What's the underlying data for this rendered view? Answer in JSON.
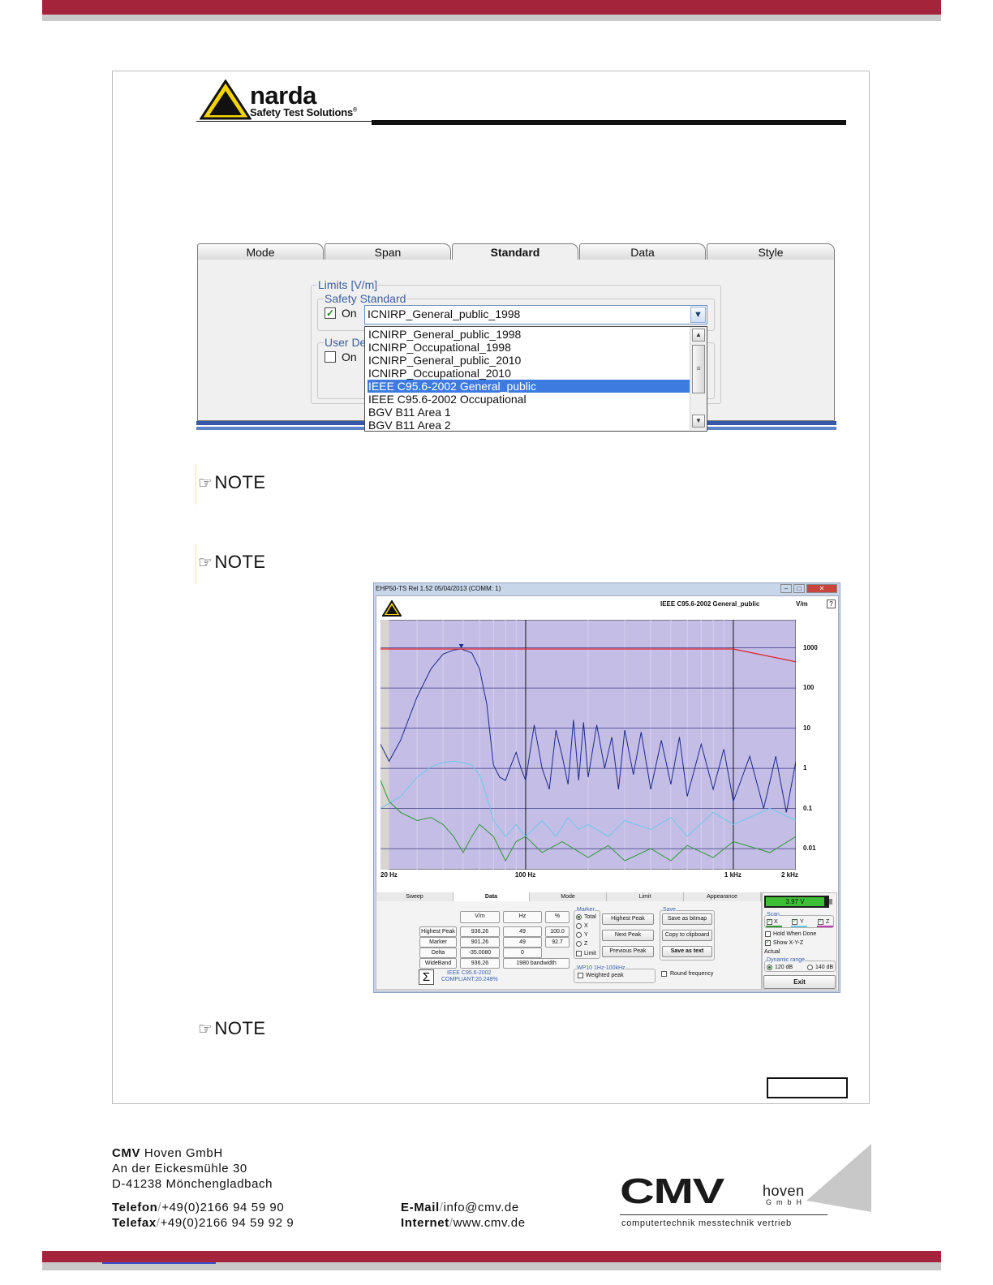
{
  "header": {
    "logo_name": "narda",
    "logo_sub": "Safety Test Solutions",
    "logo_reg": "®"
  },
  "tabs": [
    "Mode",
    "Span",
    "Standard",
    "Data",
    "Style"
  ],
  "limits": {
    "group_label": "Limits [V/m]",
    "safety_label": "Safety Standard",
    "on_label": "On",
    "selected": "ICNIRP_General_public_1998",
    "user_label": "User De",
    "user_on_label": "On",
    "options": [
      "ICNIRP_General_public_1998",
      "ICNIRP_Occupational_1998",
      "ICNIRP_General_public_2010",
      "ICNIRP_Occupational_2010",
      "IEEE C95.6-2002 General_public",
      "IEEE C95.6-2002 Occupational",
      "BGV B11 Area 1",
      "BGV B11 Area 2"
    ],
    "highlighted_index": 4
  },
  "notes": [
    "NOTE",
    "NOTE",
    "NOTE"
  ],
  "software": {
    "title": "EHP50-TS Rel 1.52 05/04/2013 (COMM: 1)",
    "standard": "IEEE C95.6-2002 General_public",
    "unit": "V/m",
    "help": "?",
    "tabs": [
      "Sweep",
      "Data",
      "Mode",
      "Limit",
      "Appearance"
    ],
    "columns": [
      "V/m",
      "Hz",
      "%"
    ],
    "rows": [
      {
        "label": "Highest Peak",
        "vm": "936.26",
        "hz": "49",
        "pct": "100.0"
      },
      {
        "label": "Marker",
        "vm": "901.26",
        "hz": "49",
        "pct": "92.7"
      },
      {
        "label": "Delta",
        "vm": "-35.0080",
        "hz": "0",
        "pct": ""
      },
      {
        "label": "WideBand",
        "vm": "936.26",
        "hz": "1980 bandwidth",
        "pct": ""
      }
    ],
    "compliance": [
      "IEEE C95.6-2002",
      "COMPLIANT:20.248%"
    ],
    "sigma": "Σ",
    "marker_group": "Marker",
    "marker_options": [
      "Total",
      "X",
      "Y",
      "Z"
    ],
    "limit_label": "Limit",
    "marker_buttons": [
      "Highest Peak",
      "Next Peak",
      "Previous Peak"
    ],
    "save_group": "Save",
    "save_buttons": [
      "Save as bitmap",
      "Copy to clipboard",
      "Save as text"
    ],
    "wp_group": "WP10 1Hz-100kHz",
    "weighted_peak": "Weighted peak",
    "round_freq": "Round frequency",
    "battery": "3.97 V",
    "scan_label": "Scan",
    "scan_axes": [
      "X",
      "Y",
      "Z"
    ],
    "hold_label": "Hold When Done",
    "show_label": "Show X-Y-Z",
    "actual_label": "Actual",
    "dyn_label": "Dynamic range",
    "dyn_options": [
      "120 dB",
      "140 dB"
    ],
    "exit": "Exit"
  },
  "chart_data": {
    "type": "line",
    "xscale": "log",
    "yscale": "log",
    "x_ticks": [
      "20 Hz",
      "100 Hz",
      "1 kHz",
      "2 kHz"
    ],
    "y_ticks": [
      "1000",
      "100",
      "10",
      "1",
      "0.1",
      "0.01"
    ],
    "xlim": [
      20,
      2000
    ],
    "ylim": [
      0.003,
      5000
    ],
    "limit_line": {
      "x": [
        20,
        1000,
        2000
      ],
      "y": [
        936,
        936,
        450
      ]
    },
    "series": [
      {
        "color": "#1a2a8c",
        "x": [
          20,
          22,
          25,
          30,
          35,
          40,
          45,
          49,
          55,
          60,
          65,
          70,
          75,
          80,
          85,
          90,
          95,
          100,
          110,
          120,
          130,
          140,
          150,
          160,
          170,
          180,
          190,
          200,
          220,
          240,
          260,
          280,
          300,
          330,
          360,
          400,
          450,
          500,
          550,
          600,
          700,
          800,
          900,
          1000,
          1200,
          1400,
          1600,
          1800,
          2000
        ],
        "y": [
          4,
          1.5,
          5,
          60,
          300,
          700,
          880,
          936,
          750,
          300,
          40,
          1.2,
          0.6,
          0.5,
          1.2,
          2.5,
          1.0,
          0.5,
          12,
          1.0,
          0.3,
          9,
          2,
          0.4,
          16,
          0.5,
          14,
          0.6,
          12,
          1.0,
          6,
          0.3,
          9,
          0.7,
          8,
          0.3,
          5,
          0.4,
          6,
          0.2,
          4,
          0.3,
          3,
          0.15,
          2,
          0.1,
          2,
          0.08,
          1.5
        ]
      },
      {
        "color": "#6ec7ea",
        "x": [
          20,
          25,
          30,
          35,
          40,
          45,
          50,
          55,
          60,
          65,
          70,
          80,
          90,
          100,
          120,
          140,
          160,
          180,
          200,
          250,
          300,
          400,
          500,
          600,
          800,
          1000,
          1500,
          2000
        ],
        "y": [
          0.1,
          0.2,
          0.6,
          1.1,
          1.4,
          1.5,
          1.4,
          1.2,
          0.7,
          0.2,
          0.05,
          0.02,
          0.04,
          0.02,
          0.05,
          0.02,
          0.06,
          0.03,
          0.04,
          0.02,
          0.05,
          0.03,
          0.06,
          0.02,
          0.08,
          0.04,
          0.1,
          0.05
        ]
      },
      {
        "color": "#2f9a34",
        "x": [
          20,
          22,
          25,
          30,
          35,
          40,
          45,
          50,
          55,
          60,
          70,
          80,
          90,
          100,
          120,
          150,
          200,
          250,
          300,
          400,
          500,
          600,
          800,
          1000,
          1500,
          2000
        ],
        "y": [
          0.5,
          0.15,
          0.08,
          0.05,
          0.06,
          0.04,
          0.02,
          0.008,
          0.02,
          0.04,
          0.02,
          0.005,
          0.015,
          0.02,
          0.008,
          0.015,
          0.006,
          0.012,
          0.005,
          0.01,
          0.005,
          0.012,
          0.006,
          0.015,
          0.008,
          0.02
        ]
      }
    ],
    "marker": {
      "x": 49,
      "y": 936
    }
  },
  "footer": {
    "company_bold": "CMV",
    "company_rest": " Hoven GmbH",
    "street": "An der Eickesmühle 30",
    "city": "D-41238 Mönchengladbach",
    "tel_label": "Telefon",
    "tel": "+49(0)2166 94 59 90",
    "fax_label": "Telefax",
    "fax": "+49(0)2166 94 59 92 9",
    "email_label": "E-Mail",
    "email": "info@cmv.de",
    "web_label": "Internet",
    "web": "www.cmv.de",
    "logo_cmv": "CMV",
    "logo_hoven": "hoven",
    "logo_gmbh": "GmbH",
    "logo_tag": "computertechnik messtechnik vertrieb"
  }
}
